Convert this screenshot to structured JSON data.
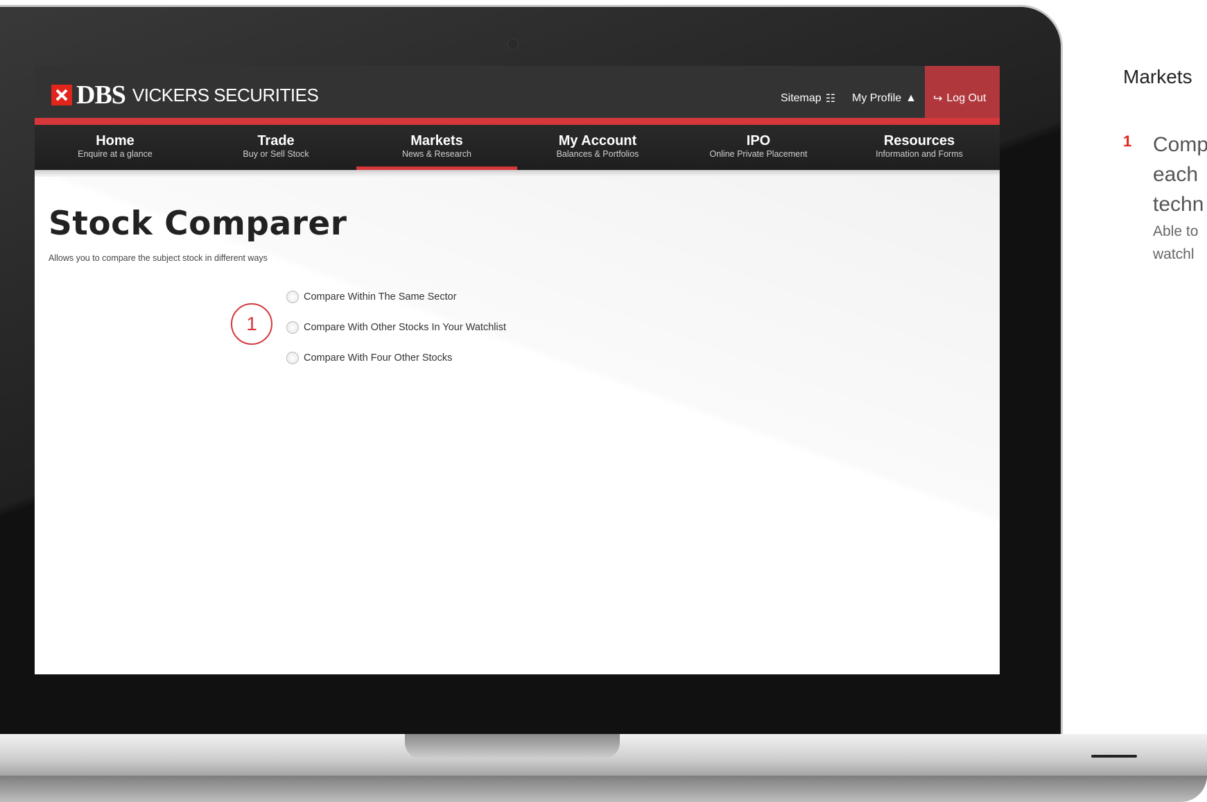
{
  "logo": {
    "mark_text": "DBS",
    "rest_text": "VICKERS SECURITIES"
  },
  "util": {
    "sitemap_label": "Sitemap",
    "sitemap_icon": "sitemap-icon",
    "profile_label": "My Profile",
    "profile_icon": "user-icon",
    "logout_label": "Log Out",
    "logout_icon": "logout-icon"
  },
  "nav": [
    {
      "title": "Home",
      "sub": "Enquire at a glance"
    },
    {
      "title": "Trade",
      "sub": "Buy or Sell Stock"
    },
    {
      "title": "Markets",
      "sub": "News & Research"
    },
    {
      "title": "My Account",
      "sub": "Balances & Portfolios"
    },
    {
      "title": "IPO",
      "sub": "Online Private Placement"
    },
    {
      "title": "Resources",
      "sub": "Information and Forms"
    }
  ],
  "active_nav": "Markets",
  "page": {
    "title": "Stock Comparer",
    "description": "Allows you to compare the subject stock in different ways"
  },
  "options": [
    "Compare Within The Same Sector",
    "Compare With Other Stocks In Your Watchlist",
    "Compare With Four Other Stocks"
  ],
  "callout": {
    "number": "1"
  },
  "right_panel": {
    "heading": "Markets",
    "item_number": "1",
    "item_line1": "Comp",
    "item_line2": "each",
    "item_line3": "techn",
    "desc_line1": "Able to",
    "desc_line2": "watchl"
  },
  "colors": {
    "brand_red": "#e1251b",
    "nav_bg": "#333333",
    "logout_bg": "#b0383c"
  }
}
